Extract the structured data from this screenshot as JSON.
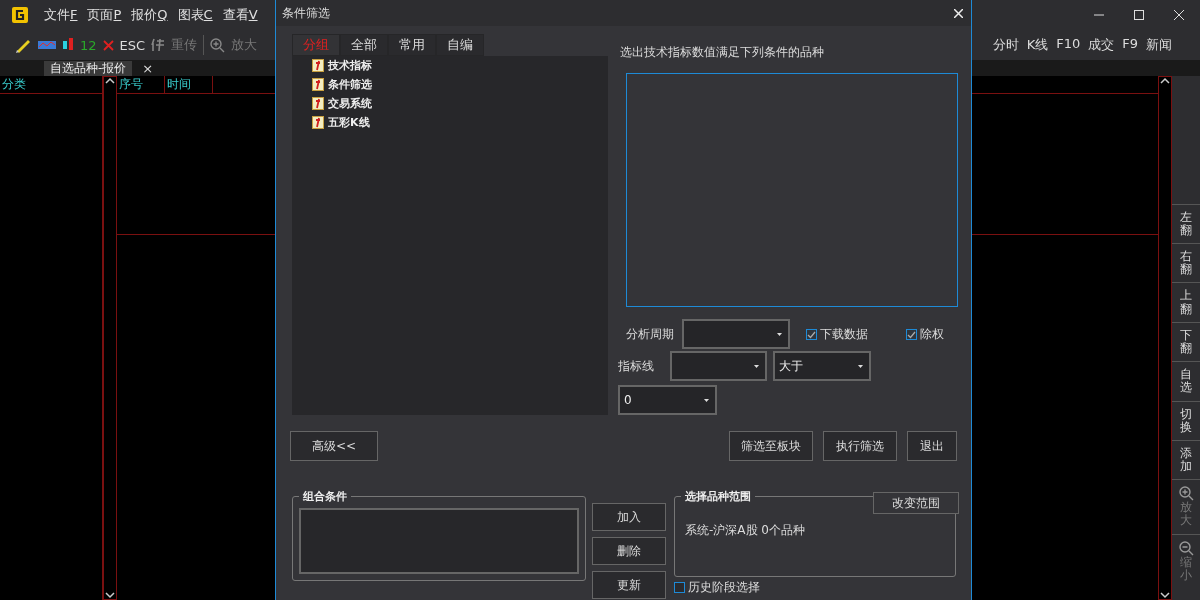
{
  "app": {
    "menus": [
      {
        "label": "文件",
        "key": "F"
      },
      {
        "label": "页面",
        "key": "P"
      },
      {
        "label": "报价",
        "key": "Q"
      },
      {
        "label": "图表",
        "key": "C"
      },
      {
        "label": "查看",
        "key": "V"
      }
    ],
    "toolbar": {
      "count": "12",
      "esc": "ESC",
      "resend": {
        "label": "重传",
        "disabled": true
      },
      "zoom": {
        "label": "放大",
        "disabled": true
      }
    },
    "quick_links": [
      "分时",
      "K线",
      "F10",
      "成交",
      "F9",
      "新闻"
    ],
    "tabs": [
      {
        "label": "自选品种-报价",
        "selected": true
      }
    ],
    "tab_close": "×",
    "category_header": "分类",
    "columns": [
      "序号",
      "时间"
    ],
    "side_buttons": [
      {
        "label": "左翻",
        "kind": "text",
        "disabled": false
      },
      {
        "label": "右翻",
        "kind": "text",
        "disabled": false
      },
      {
        "label": "上翻",
        "kind": "text",
        "disabled": false
      },
      {
        "label": "下翻",
        "kind": "text",
        "disabled": false
      },
      {
        "label": "自选",
        "kind": "text",
        "disabled": false
      },
      {
        "label": "切换",
        "kind": "text",
        "disabled": false
      },
      {
        "label": "添加",
        "kind": "text",
        "disabled": false
      },
      {
        "label": "放大",
        "kind": "zoom-in",
        "disabled": true
      },
      {
        "label": "缩小",
        "kind": "zoom-out",
        "disabled": true
      }
    ]
  },
  "dialog": {
    "title": "条件筛选",
    "tabs": [
      {
        "label": "分组",
        "selected": true
      },
      {
        "label": "全部",
        "selected": false
      },
      {
        "label": "常用",
        "selected": false
      },
      {
        "label": "自编",
        "selected": false
      }
    ],
    "tree": [
      "技术指标",
      "条件筛选",
      "交易系统",
      "五彩K线"
    ],
    "prompt": "选出技术指标数值满足下列条件的品种",
    "period_label": "分析周期",
    "download": {
      "label": "下载数据",
      "checked": true
    },
    "exright": {
      "label": "除权",
      "checked": true
    },
    "line_label": "指标线",
    "compare_value": "大于",
    "threshold_value": "0",
    "advanced_button": "高级<<",
    "action_buttons": [
      "筛选至板块",
      "执行筛选",
      "退出"
    ],
    "combo_title": "组合条件",
    "combo_buttons": [
      "加入",
      "删除",
      "更新"
    ],
    "scope_title": "选择品种范围",
    "scope_button": "改变范围",
    "scope_text": "系统-沪深A股 0个品种",
    "history": {
      "label": "历史阶段选择",
      "checked": false
    }
  }
}
